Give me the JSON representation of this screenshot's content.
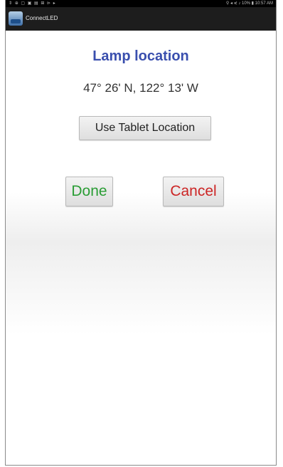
{
  "statusbar": {
    "left_icons": "⇕ ⊕ ▢ ▣ ▤ ⊞ ⊳ ▸",
    "right_text": "⚲ ◂ ⋞ ♪ 10% ▮ 10:57 AM"
  },
  "app": {
    "title": "ConnectLED",
    "icon": "app-logo-icon"
  },
  "page": {
    "title": "Lamp location",
    "coordinates": "47° 26' N, 122° 13' W"
  },
  "buttons": {
    "use_location": "Use Tablet Location",
    "done": "Done",
    "cancel": "Cancel"
  },
  "colors": {
    "title": "#3a4fae",
    "done": "#2a9d35",
    "cancel": "#cc2525",
    "actionbar": "#1d1d1d"
  }
}
